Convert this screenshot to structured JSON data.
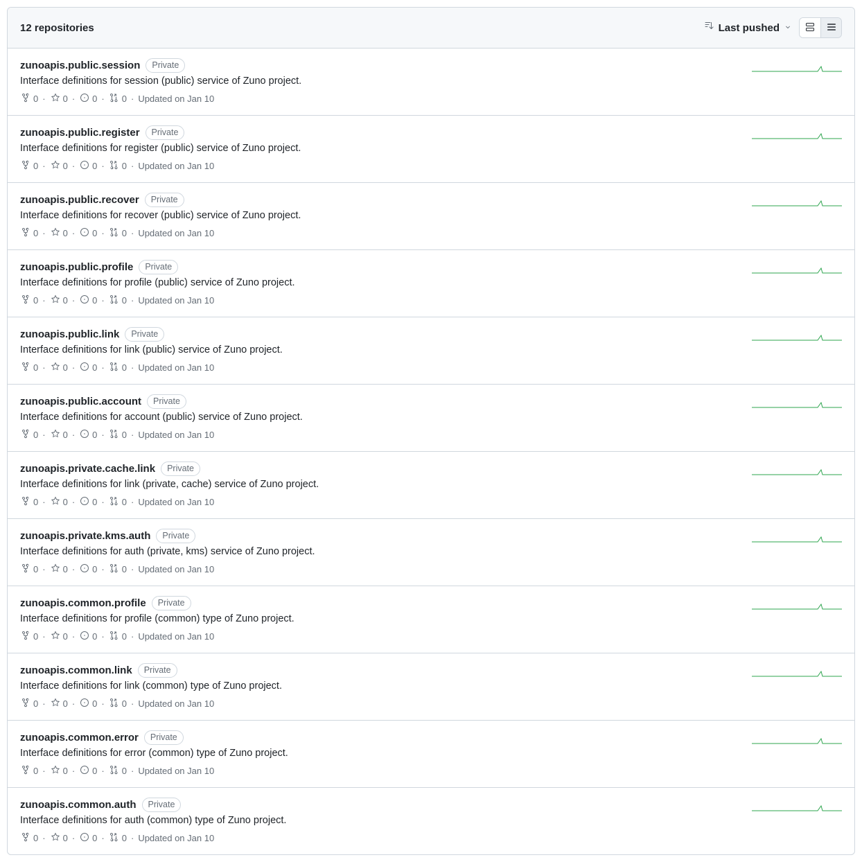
{
  "header": {
    "count_label": "12 repositories",
    "sort_label": "Last pushed"
  },
  "repos": [
    {
      "name": "zunoapis.public.session",
      "badge": "Private",
      "description": "Interface definitions for session (public) service of Zuno project.",
      "forks": "0",
      "stars": "0",
      "issues": "0",
      "pulls": "0",
      "updated": "Updated on Jan 10"
    },
    {
      "name": "zunoapis.public.register",
      "badge": "Private",
      "description": "Interface definitions for register (public) service of Zuno project.",
      "forks": "0",
      "stars": "0",
      "issues": "0",
      "pulls": "0",
      "updated": "Updated on Jan 10"
    },
    {
      "name": "zunoapis.public.recover",
      "badge": "Private",
      "description": "Interface definitions for recover (public) service of Zuno project.",
      "forks": "0",
      "stars": "0",
      "issues": "0",
      "pulls": "0",
      "updated": "Updated on Jan 10"
    },
    {
      "name": "zunoapis.public.profile",
      "badge": "Private",
      "description": "Interface definitions for profile (public) service of Zuno project.",
      "forks": "0",
      "stars": "0",
      "issues": "0",
      "pulls": "0",
      "updated": "Updated on Jan 10"
    },
    {
      "name": "zunoapis.public.link",
      "badge": "Private",
      "description": "Interface definitions for link (public) service of Zuno project.",
      "forks": "0",
      "stars": "0",
      "issues": "0",
      "pulls": "0",
      "updated": "Updated on Jan 10"
    },
    {
      "name": "zunoapis.public.account",
      "badge": "Private",
      "description": "Interface definitions for account (public) service of Zuno project.",
      "forks": "0",
      "stars": "0",
      "issues": "0",
      "pulls": "0",
      "updated": "Updated on Jan 10"
    },
    {
      "name": "zunoapis.private.cache.link",
      "badge": "Private",
      "description": "Interface definitions for link (private, cache) service of Zuno project.",
      "forks": "0",
      "stars": "0",
      "issues": "0",
      "pulls": "0",
      "updated": "Updated on Jan 10"
    },
    {
      "name": "zunoapis.private.kms.auth",
      "badge": "Private",
      "description": "Interface definitions for auth (private, kms) service of Zuno project.",
      "forks": "0",
      "stars": "0",
      "issues": "0",
      "pulls": "0",
      "updated": "Updated on Jan 10"
    },
    {
      "name": "zunoapis.common.profile",
      "badge": "Private",
      "description": "Interface definitions for profile (common) type of Zuno project.",
      "forks": "0",
      "stars": "0",
      "issues": "0",
      "pulls": "0",
      "updated": "Updated on Jan 10"
    },
    {
      "name": "zunoapis.common.link",
      "badge": "Private",
      "description": "Interface definitions for link (common) type of Zuno project.",
      "forks": "0",
      "stars": "0",
      "issues": "0",
      "pulls": "0",
      "updated": "Updated on Jan 10"
    },
    {
      "name": "zunoapis.common.error",
      "badge": "Private",
      "description": "Interface definitions for error (common) type of Zuno project.",
      "forks": "0",
      "stars": "0",
      "issues": "0",
      "pulls": "0",
      "updated": "Updated on Jan 10"
    },
    {
      "name": "zunoapis.common.auth",
      "badge": "Private",
      "description": "Interface definitions for auth (common) type of Zuno project.",
      "forks": "0",
      "stars": "0",
      "issues": "0",
      "pulls": "0",
      "updated": "Updated on Jan 10"
    }
  ]
}
